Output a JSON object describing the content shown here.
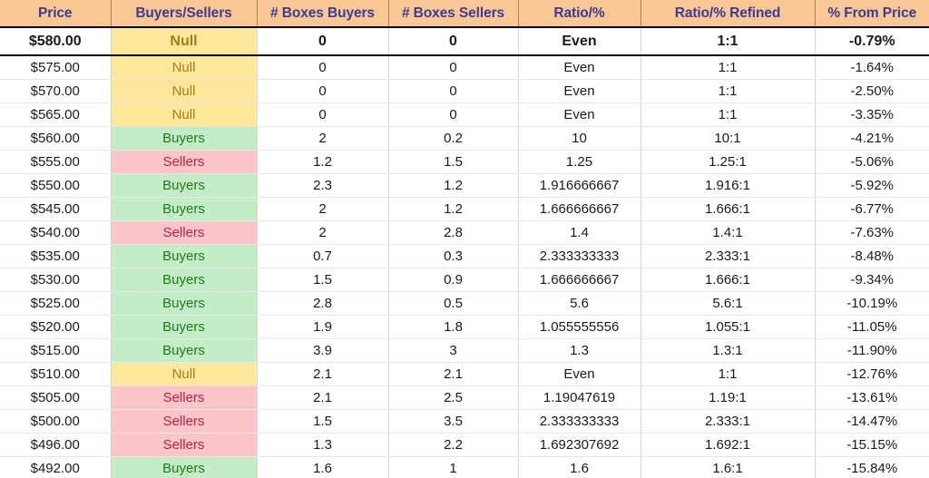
{
  "table": {
    "columns": [
      {
        "key": "price",
        "label": "Price"
      },
      {
        "key": "buyers_sellers",
        "label": "Buyers/Sellers"
      },
      {
        "key": "boxes_buyers",
        "label": "# Boxes Buyers"
      },
      {
        "key": "boxes_sellers",
        "label": "# Boxes Sellers"
      },
      {
        "key": "ratio_pct",
        "label": "Ratio/%"
      },
      {
        "key": "ratio_refined",
        "label": "Ratio/% Refined"
      },
      {
        "key": "pct_from_price",
        "label": "% From Price"
      }
    ],
    "rows": [
      {
        "price": "$580.00",
        "buyers_sellers": "Null",
        "category": "null",
        "boxes_buyers": "0",
        "boxes_sellers": "0",
        "ratio_pct": "Even",
        "ratio_refined": "1:1",
        "pct_from_price": "-0.79%",
        "highlighted": true
      },
      {
        "price": "$575.00",
        "buyers_sellers": "Null",
        "category": "null",
        "boxes_buyers": "0",
        "boxes_sellers": "0",
        "ratio_pct": "Even",
        "ratio_refined": "1:1",
        "pct_from_price": "-1.64%",
        "highlighted": false
      },
      {
        "price": "$570.00",
        "buyers_sellers": "Null",
        "category": "null",
        "boxes_buyers": "0",
        "boxes_sellers": "0",
        "ratio_pct": "Even",
        "ratio_refined": "1:1",
        "pct_from_price": "-2.50%",
        "highlighted": false
      },
      {
        "price": "$565.00",
        "buyers_sellers": "Null",
        "category": "null",
        "boxes_buyers": "0",
        "boxes_sellers": "0",
        "ratio_pct": "Even",
        "ratio_refined": "1:1",
        "pct_from_price": "-3.35%",
        "highlighted": false
      },
      {
        "price": "$560.00",
        "buyers_sellers": "Buyers",
        "category": "buyers",
        "boxes_buyers": "2",
        "boxes_sellers": "0.2",
        "ratio_pct": "10",
        "ratio_refined": "10:1",
        "pct_from_price": "-4.21%",
        "highlighted": false
      },
      {
        "price": "$555.00",
        "buyers_sellers": "Sellers",
        "category": "sellers",
        "boxes_buyers": "1.2",
        "boxes_sellers": "1.5",
        "ratio_pct": "1.25",
        "ratio_refined": "1.25:1",
        "pct_from_price": "-5.06%",
        "highlighted": false
      },
      {
        "price": "$550.00",
        "buyers_sellers": "Buyers",
        "category": "buyers",
        "boxes_buyers": "2.3",
        "boxes_sellers": "1.2",
        "ratio_pct": "1.916666667",
        "ratio_refined": "1.916:1",
        "pct_from_price": "-5.92%",
        "highlighted": false
      },
      {
        "price": "$545.00",
        "buyers_sellers": "Buyers",
        "category": "buyers",
        "boxes_buyers": "2",
        "boxes_sellers": "1.2",
        "ratio_pct": "1.666666667",
        "ratio_refined": "1.666:1",
        "pct_from_price": "-6.77%",
        "highlighted": false
      },
      {
        "price": "$540.00",
        "buyers_sellers": "Sellers",
        "category": "sellers",
        "boxes_buyers": "2",
        "boxes_sellers": "2.8",
        "ratio_pct": "1.4",
        "ratio_refined": "1.4:1",
        "pct_from_price": "-7.63%",
        "highlighted": false
      },
      {
        "price": "$535.00",
        "buyers_sellers": "Buyers",
        "category": "buyers",
        "boxes_buyers": "0.7",
        "boxes_sellers": "0.3",
        "ratio_pct": "2.333333333",
        "ratio_refined": "2.333:1",
        "pct_from_price": "-8.48%",
        "highlighted": false
      },
      {
        "price": "$530.00",
        "buyers_sellers": "Buyers",
        "category": "buyers",
        "boxes_buyers": "1.5",
        "boxes_sellers": "0.9",
        "ratio_pct": "1.666666667",
        "ratio_refined": "1.666:1",
        "pct_from_price": "-9.34%",
        "highlighted": false
      },
      {
        "price": "$525.00",
        "buyers_sellers": "Buyers",
        "category": "buyers",
        "boxes_buyers": "2.8",
        "boxes_sellers": "0.5",
        "ratio_pct": "5.6",
        "ratio_refined": "5.6:1",
        "pct_from_price": "-10.19%",
        "highlighted": false
      },
      {
        "price": "$520.00",
        "buyers_sellers": "Buyers",
        "category": "buyers",
        "boxes_buyers": "1.9",
        "boxes_sellers": "1.8",
        "ratio_pct": "1.055555556",
        "ratio_refined": "1.055:1",
        "pct_from_price": "-11.05%",
        "highlighted": false
      },
      {
        "price": "$515.00",
        "buyers_sellers": "Buyers",
        "category": "buyers",
        "boxes_buyers": "3.9",
        "boxes_sellers": "3",
        "ratio_pct": "1.3",
        "ratio_refined": "1.3:1",
        "pct_from_price": "-11.90%",
        "highlighted": false
      },
      {
        "price": "$510.00",
        "buyers_sellers": "Null",
        "category": "null",
        "boxes_buyers": "2.1",
        "boxes_sellers": "2.1",
        "ratio_pct": "Even",
        "ratio_refined": "1:1",
        "pct_from_price": "-12.76%",
        "highlighted": false
      },
      {
        "price": "$505.00",
        "buyers_sellers": "Sellers",
        "category": "sellers",
        "boxes_buyers": "2.1",
        "boxes_sellers": "2.5",
        "ratio_pct": "1.19047619",
        "ratio_refined": "1.19:1",
        "pct_from_price": "-13.61%",
        "highlighted": false
      },
      {
        "price": "$500.00",
        "buyers_sellers": "Sellers",
        "category": "sellers",
        "boxes_buyers": "1.5",
        "boxes_sellers": "3.5",
        "ratio_pct": "2.333333333",
        "ratio_refined": "2.333:1",
        "pct_from_price": "-14.47%",
        "highlighted": false
      },
      {
        "price": "$496.00",
        "buyers_sellers": "Sellers",
        "category": "sellers",
        "boxes_buyers": "1.3",
        "boxes_sellers": "2.2",
        "ratio_pct": "1.692307692",
        "ratio_refined": "1.692:1",
        "pct_from_price": "-15.15%",
        "highlighted": false
      },
      {
        "price": "$492.00",
        "buyers_sellers": "Buyers",
        "category": "buyers",
        "boxes_buyers": "1.6",
        "boxes_sellers": "1",
        "ratio_pct": "1.6",
        "ratio_refined": "1.6:1",
        "pct_from_price": "-15.84%",
        "highlighted": false
      }
    ]
  },
  "colors": {
    "header_bg": "#f9c795",
    "header_text": "#3b3b8f",
    "null_bg": "#fce79b",
    "null_text": "#a57c1b",
    "buyers_bg": "#c4ecc6",
    "buyers_text": "#1f7a1f",
    "sellers_bg": "#fcc5ca",
    "sellers_text": "#c0203a",
    "grid_line": "#d9d9d9",
    "emphasis_border": "#000000"
  }
}
